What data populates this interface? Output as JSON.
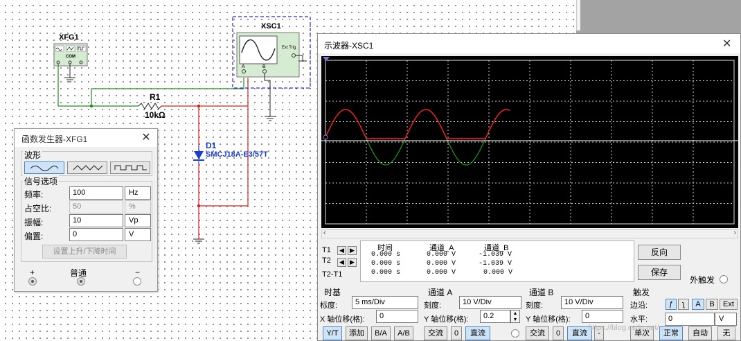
{
  "schematic": {
    "xfg_label": "XFG1",
    "xfg_com": "COM",
    "xsc_label": "XSC1",
    "xsc_ext_trig": "Ext Trig",
    "xsc_a": "A",
    "xsc_b": "B",
    "r1_label": "R1",
    "r1_value": "10kΩ",
    "d1_label": "D1",
    "d1_part": "SMCJ18A-E3/57T"
  },
  "funcgen": {
    "title": "函数发生器-XFG1",
    "waveform_group": "波形",
    "signal_group": "信号选项",
    "freq_label": "频率:",
    "freq_value": "100",
    "freq_unit": "Hz",
    "duty_label": "占空比:",
    "duty_value": "50",
    "duty_unit": "%",
    "amp_label": "振幅:",
    "amp_value": "10",
    "amp_unit": "Vp",
    "offset_label": "偏置:",
    "offset_value": "0",
    "offset_unit": "V",
    "rise_fall_button": "设置上升/下降时间",
    "plus": "+",
    "common": "普通",
    "minus": "−",
    "selected_waveform": "sine"
  },
  "scope": {
    "title": "示波器-XSC1",
    "readout": {
      "headers": [
        "时间",
        "通道_A",
        "通道_B"
      ],
      "rows": [
        {
          "label": "T1",
          "time": "0.000 s",
          "a": "0.000 V",
          "b": "-1.039 V"
        },
        {
          "label": "T2",
          "time": "0.000 s",
          "a": "0.000 V",
          "b": "-1.039 V"
        },
        {
          "label": "T2-T1",
          "time": "0.000 s",
          "a": "0.000 V",
          "b": "0.000 V"
        }
      ]
    },
    "reverse_button": "反向",
    "save_button": "保存",
    "ext_trigger": "外触发",
    "timebase": {
      "title": "时基",
      "scale_label": "标度:",
      "scale_value": "5 ms/Div",
      "xpos_label": "X 轴位移(格):",
      "xpos_value": "0",
      "buttons": [
        "Y/T",
        "添加",
        "B/A",
        "A/B"
      ]
    },
    "channel_a": {
      "title": "通道 A",
      "scale_label": "刻度:",
      "scale_value": "10  V/Div",
      "ypos_label": "Y 轴位移(格):",
      "ypos_value": "0.2",
      "buttons": [
        "交流",
        "0",
        "直流"
      ]
    },
    "channel_b": {
      "title": "通道 B",
      "scale_label": "刻度:",
      "scale_value": "10  V/Div",
      "ypos_label": "Y 轴位移(格):",
      "ypos_value": "0",
      "buttons": [
        "交流",
        "0",
        "直流",
        "-"
      ]
    },
    "trigger": {
      "title": "触发",
      "edge_label": "边沿:",
      "edge_buttons": [
        "A",
        "B",
        "Ext"
      ],
      "level_label": "水平:",
      "level_value": "0",
      "level_unit": "V",
      "mode_buttons": [
        "单次",
        "正常",
        "自动",
        "无"
      ]
    },
    "colors": {
      "channel_a": "#ff2020",
      "channel_b": "#1faa1f",
      "screen": "#000000",
      "grid": "#cfcfcf",
      "wire_green": "#1e8c1e",
      "wire_red": "#d42020",
      "diode_blue": "#1a3cd4"
    }
  },
  "watermark": "https://blog.csdn.net/..."
}
